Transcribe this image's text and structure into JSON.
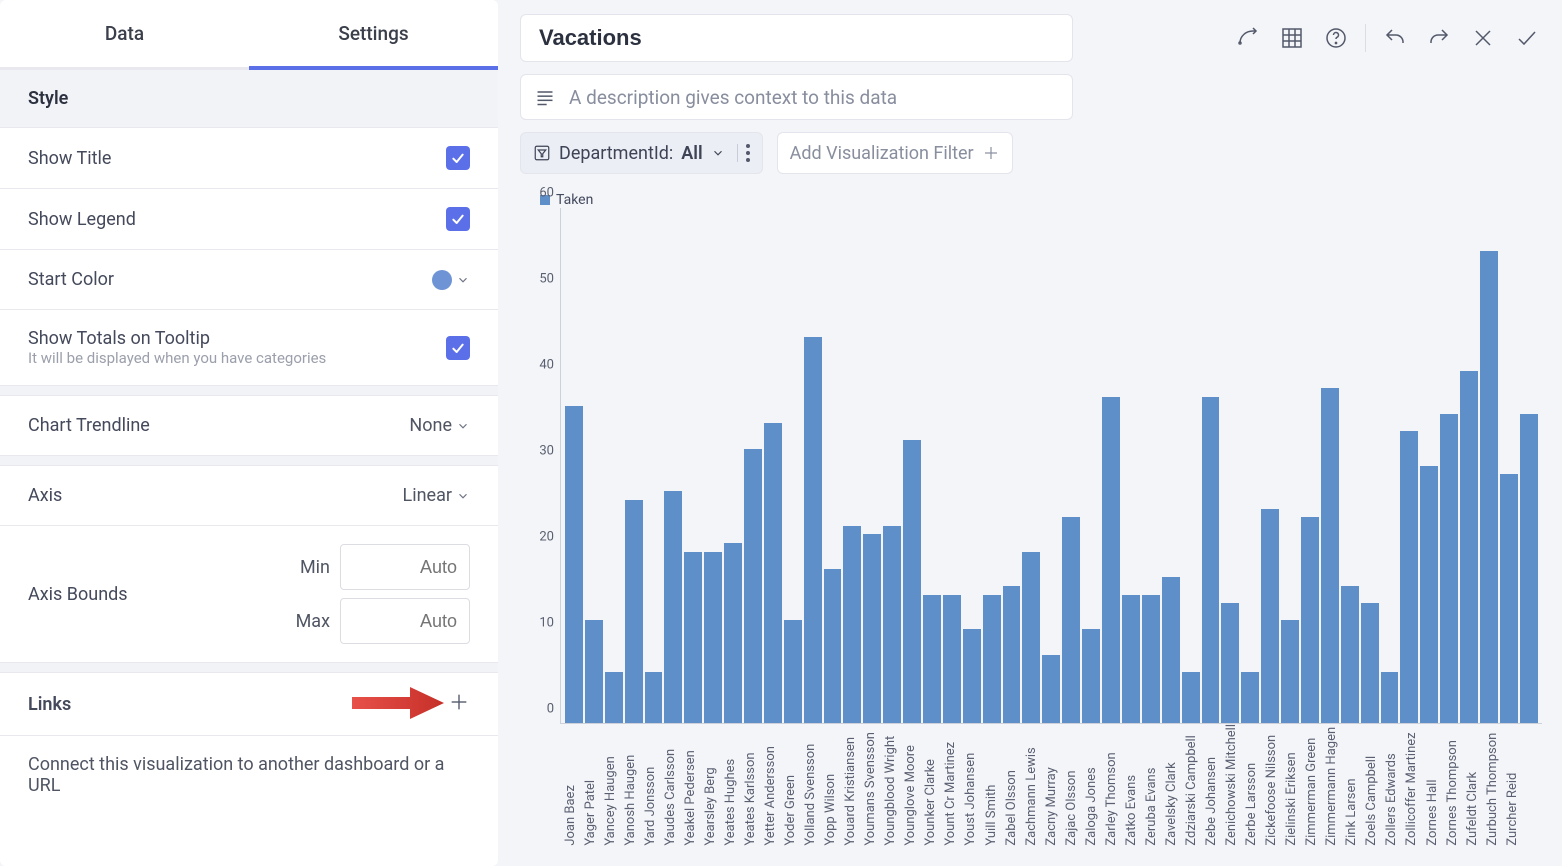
{
  "tabs": {
    "data": "Data",
    "settings": "Settings"
  },
  "side": {
    "style_head": "Style",
    "show_title": "Show Title",
    "show_legend": "Show Legend",
    "start_color": "Start Color",
    "show_totals": "Show Totals on Tooltip",
    "show_totals_sub": "It will be displayed when you have categories",
    "chart_trendline": "Chart Trendline",
    "trendline_val": "None",
    "axis": "Axis",
    "axis_val": "Linear",
    "axis_bounds": "Axis Bounds",
    "min": "Min",
    "max": "Max",
    "auto": "Auto",
    "links_head": "Links",
    "links_help": "Connect this visualization to another dashboard or a URL"
  },
  "main": {
    "title": "Vacations",
    "desc_placeholder": "A description gives context to this data",
    "filter_label": "DepartmentId:",
    "filter_value": "All",
    "add_filter": "Add Visualization Filter"
  },
  "chart_data": {
    "type": "bar",
    "series_name": "Taken",
    "ylim": [
      0,
      60
    ],
    "yticks": [
      0,
      10,
      20,
      30,
      40,
      50,
      60
    ],
    "categories": [
      "Joan Baez",
      "Yager Patel",
      "Yancey Haugen",
      "Yanosh Haugen",
      "Yard Jonsson",
      "Yaudes Carlsson",
      "Yeakel Pedersen",
      "Yearsley Berg",
      "Yeates Hughes",
      "Yeates Karlsson",
      "Yetter Andersson",
      "Yoder Green",
      "Yolland Svensson",
      "Yopp Wilson",
      "Youard Kristiansen",
      "Youmans Svensson",
      "Youngblood Wright",
      "Younglove Moore",
      "Younker Clarke",
      "Yount Cr Martinez",
      "Youst Johansen",
      "Yuill Smith",
      "Zabel Olsson",
      "Zachmann Lewis",
      "Zacny Murray",
      "Zajac Olsson",
      "Zaloga Jones",
      "Zarley Thomson",
      "Zatko Evans",
      "Zeruba Evans",
      "Zavelsky Clark",
      "Zdziarski Campbell",
      "Zebe Johansen",
      "Zenichowski Mitchell",
      "Zerbe Larsson",
      "Zickefoose Nilsson",
      "Zielinski Eriksen",
      "Zimmerman Green",
      "Zimmermann Hagen",
      "Zink Larsen",
      "Zoels Campbell",
      "Zollers Edwards",
      "Zollicoffer Martinez",
      "Zornes Hall",
      "Zornes Thompson",
      "Zufeldt Clark",
      "Zurbuch Thompson",
      "Zurcher Reid"
    ],
    "values": [
      37,
      12,
      6,
      26,
      6,
      27,
      20,
      20,
      21,
      32,
      35,
      12,
      45,
      18,
      23,
      22,
      23,
      33,
      15,
      15,
      11,
      15,
      16,
      20,
      8,
      24,
      11,
      38,
      15,
      15,
      17,
      6,
      38,
      14,
      6,
      25,
      12,
      24,
      39,
      16,
      14,
      6,
      34,
      30,
      36,
      41,
      55,
      29,
      36
    ]
  }
}
